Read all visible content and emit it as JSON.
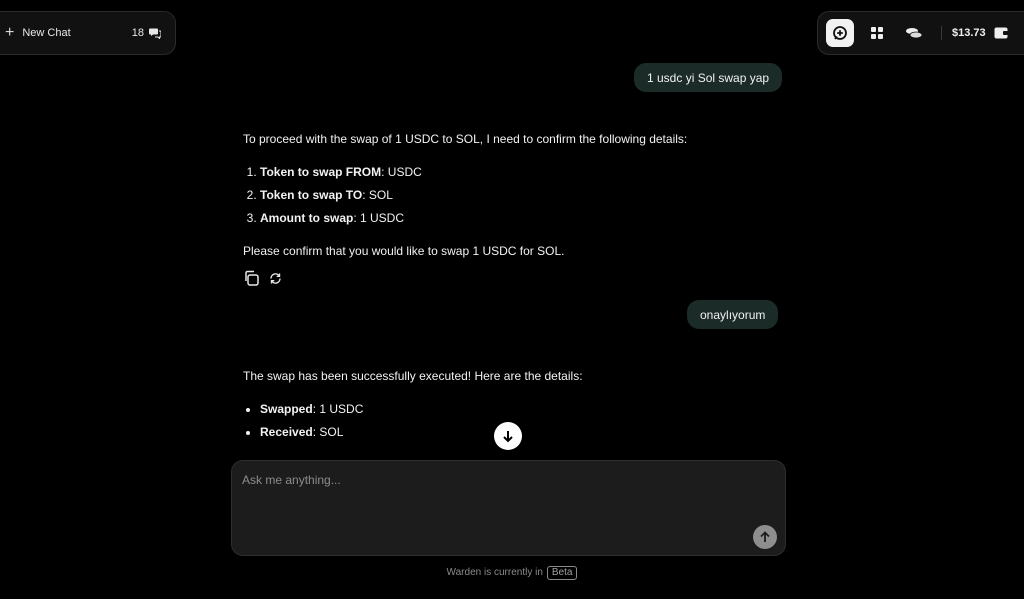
{
  "sidebar": {
    "new_chat_label": "New Chat",
    "chat_count": "18"
  },
  "toolbar": {
    "balance": "$13.73",
    "icons": [
      "new-chat-icon",
      "grid-icon",
      "coins-icon",
      "wallet-icon"
    ]
  },
  "messages": {
    "user_1": "1 usdc yi Sol swap yap",
    "assistant_1": {
      "intro": "To proceed with the swap of 1 USDC to SOL, I need to confirm the following details:",
      "items": [
        {
          "label": "Token to swap FROM",
          "value": ": USDC"
        },
        {
          "label": "Token to swap TO",
          "value": ": SOL"
        },
        {
          "label": "Amount to swap",
          "value": ": 1 USDC"
        }
      ],
      "outro": "Please confirm that you would like to swap 1 USDC for SOL."
    },
    "user_2": "onaylıyorum",
    "assistant_2": {
      "intro": "The swap has been successfully executed! Here are the details:",
      "items": [
        {
          "label": "Swapped",
          "value": ": 1 USDC"
        },
        {
          "label": "Received",
          "value": ": SOL"
        }
      ]
    }
  },
  "composer": {
    "placeholder": "Ask me anything..."
  },
  "footer": {
    "text": "Warden is currently in",
    "badge": "Beta"
  },
  "colors": {
    "background": "#000000",
    "user_bubble": "#1b2b27",
    "panel": "#111111",
    "composer": "#1c1c1c"
  }
}
